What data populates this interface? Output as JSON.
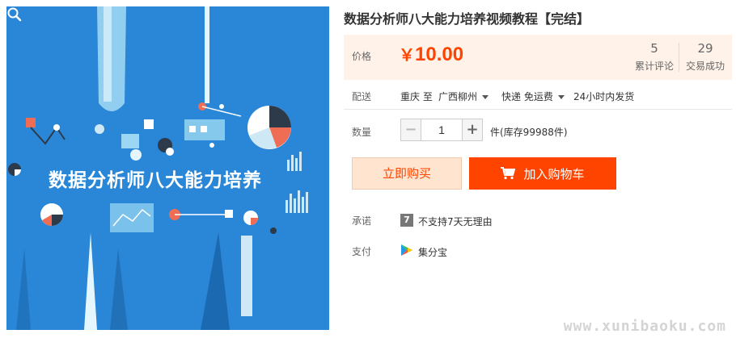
{
  "product": {
    "title": "数据分析师八大能力培养视频教程【完结】",
    "image_banner_text": "数据分析师八大能力培养"
  },
  "price": {
    "label": "价格",
    "currency": "￥",
    "amount": "10.00"
  },
  "stats": {
    "reviews_count": "5",
    "reviews_label": "累计评论",
    "sales_count": "29",
    "sales_label": "交易成功"
  },
  "delivery": {
    "label": "配送",
    "from": "重庆 至",
    "to": "广西柳州",
    "shipping": "快递 免运费",
    "dispatch": "24小时内发货"
  },
  "quantity": {
    "label": "数量",
    "minus": "−",
    "value": "1",
    "plus": "+",
    "stock": "件(库存99988件)"
  },
  "actions": {
    "buy_now": "立即购买",
    "add_to_cart": "加入购物车"
  },
  "promise": {
    "label": "承诺",
    "badge": "7",
    "text": "不支持7天无理由"
  },
  "payment": {
    "label": "支付",
    "method": "集分宝"
  },
  "watermark": "www.xunibaoku.com",
  "colors": {
    "accent": "#ff4400",
    "price_bg": "#fff2e8",
    "image_bg": "#2a86d6"
  },
  "icons": {
    "zoom": "magnifier-icon",
    "cart": "cart-icon",
    "promise": "seven-day-icon",
    "payment": "jifenbao-icon"
  }
}
